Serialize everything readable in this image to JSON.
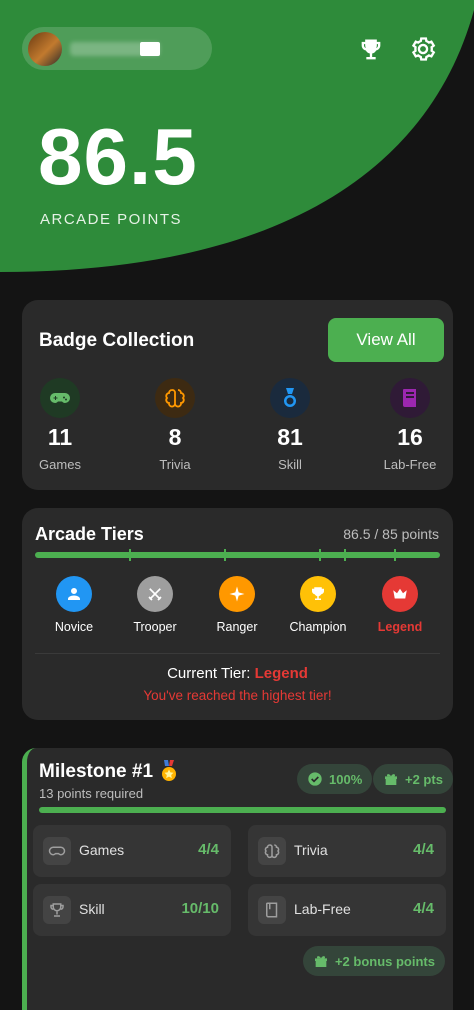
{
  "header": {
    "trophy_icon": "trophy-icon",
    "settings_icon": "gear-icon",
    "colors": {
      "hero": "#2e8b3a",
      "accent": "#4caf50"
    }
  },
  "hero": {
    "points": "86.5",
    "caption": "ARCADE POINTS"
  },
  "badges": {
    "title": "Badge Collection",
    "view_all_label": "View All",
    "items": [
      {
        "value": "11",
        "label": "Games",
        "icon": "gamepad-icon",
        "color": "#66bb6a",
        "bg": "#1f3a24"
      },
      {
        "value": "8",
        "label": "Trivia",
        "icon": "brain-icon",
        "color": "#ff9800",
        "bg": "#3d2a12"
      },
      {
        "value": "81",
        "label": "Skill",
        "icon": "medal-icon",
        "color": "#2196f3",
        "bg": "#1a2a3d"
      },
      {
        "value": "16",
        "label": "Lab-Free",
        "icon": "book-icon",
        "color": "#9c27b0",
        "bg": "#2f1a36"
      }
    ]
  },
  "tiers": {
    "title": "Arcade Tiers",
    "progress_text": "86.5 / 85 points",
    "progress": 1.0,
    "items": [
      {
        "label": "Novice",
        "color": "#2196f3",
        "icon": "person-icon",
        "active": false
      },
      {
        "label": "Trooper",
        "color": "#9e9e9e",
        "icon": "swords-icon",
        "active": false
      },
      {
        "label": "Ranger",
        "color": "#ff9800",
        "icon": "star-icon",
        "active": false
      },
      {
        "label": "Champion",
        "color": "#ffc107",
        "icon": "trophy-icon",
        "active": false
      },
      {
        "label": "Legend",
        "color": "#e53935",
        "icon": "crown-icon",
        "active": true
      }
    ],
    "current_label": "Current Tier: ",
    "current_value": "Legend",
    "note": "You've reached the highest tier!"
  },
  "milestone": {
    "title": "Milestone #1",
    "title_icon": "medal-icon",
    "subtitle": "13 points required",
    "percent": "100%",
    "pts": "+2 pts",
    "progress": 1.0,
    "requirements": [
      {
        "label": "Games",
        "value": "4/4",
        "icon": "gamepad-icon"
      },
      {
        "label": "Trivia",
        "value": "4/4",
        "icon": "brain-icon"
      },
      {
        "label": "Skill",
        "value": "10/10",
        "icon": "trophy-icon"
      },
      {
        "label": "Lab-Free",
        "value": "4/4",
        "icon": "book-icon"
      }
    ],
    "bonus": "+2 bonus points"
  }
}
